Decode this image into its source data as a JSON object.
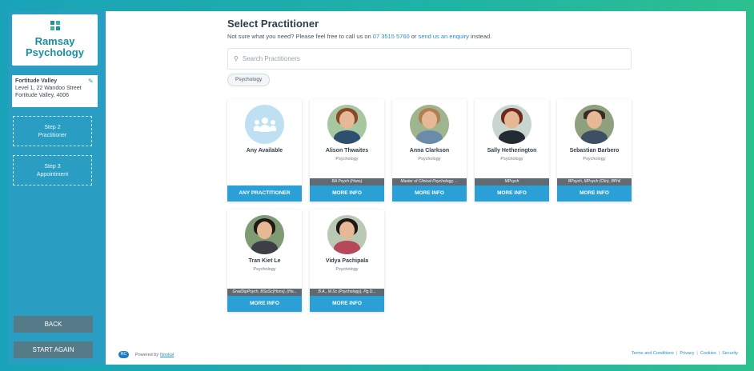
{
  "sidebar": {
    "logo": {
      "line1": "Ramsay",
      "line2": "Psychology"
    },
    "location": {
      "name": "Fortitude Valley",
      "line1": "Level 1, 22 Wandoo Street",
      "line2": "Fortitude Valley, 4006"
    },
    "steps": [
      {
        "number": "Step 2",
        "label": "Practitioner"
      },
      {
        "number": "Step 3",
        "label": "Appointment"
      }
    ],
    "back_label": "BACK",
    "start_again_label": "START AGAIN"
  },
  "main": {
    "title": "Select Practitioner",
    "subtitle_pre": "Not sure what you need? Please feel free to call us on ",
    "phone": "07 3515 5760",
    "subtitle_mid": " or ",
    "enquiry_link": "send us an enquiry",
    "subtitle_post": " instead.",
    "search_placeholder": "Search Practitioners",
    "filter_chip": "Psychology"
  },
  "any_card": {
    "name": "Any Available",
    "button": "ANY PRACTITIONER"
  },
  "practitioners": [
    {
      "name": "Alison Thwaites",
      "role": "Psychology",
      "qual": "BA Psych (Hons)",
      "button": "MORE INFO",
      "hair": "#8a4a2a",
      "body": "#2f4f6f",
      "bg": "#a7c7a0"
    },
    {
      "name": "Anna Clarkson",
      "role": "Psychology",
      "qual": "Master of Clinical Psychology, ...",
      "button": "MORE INFO",
      "hair": "#b08050",
      "body": "#6a8caa",
      "bg": "#9fb58f"
    },
    {
      "name": "Sally Hetherington",
      "role": "Psychology",
      "qual": "MPsych",
      "button": "MORE INFO",
      "hair": "#6b2b1e",
      "body": "#222a33",
      "bg": "#c9d6cf"
    },
    {
      "name": "Sebastian Barbero",
      "role": "Psychology",
      "qual": "BPsych, MPsych (Clin), BPhil",
      "button": "MORE INFO",
      "hair": "#3a2c22",
      "body": "#3c4f63",
      "bg": "#8fa07e"
    },
    {
      "name": "Tran Kiet Le",
      "role": "Psychology",
      "qual": "GradDipPsych, BSoSc(Hons), (Ho...",
      "button": "MORE INFO",
      "hair": "#1e1a18",
      "body": "#3e3e46",
      "bg": "#7f9b74"
    },
    {
      "name": "Vidya Pachipala",
      "role": "Psychology",
      "qual": "B.A., M.Sc (Psychology), Pg.D...",
      "button": "MORE INFO",
      "hair": "#201816",
      "body": "#b6485a",
      "bg": "#b9c9b3"
    }
  ],
  "footer": {
    "badge": "RC",
    "powered_by": "Powered by",
    "powered_link": "Nookal",
    "links": [
      "Terms and Conditions",
      "Privacy",
      "Cookies",
      "Security"
    ]
  }
}
